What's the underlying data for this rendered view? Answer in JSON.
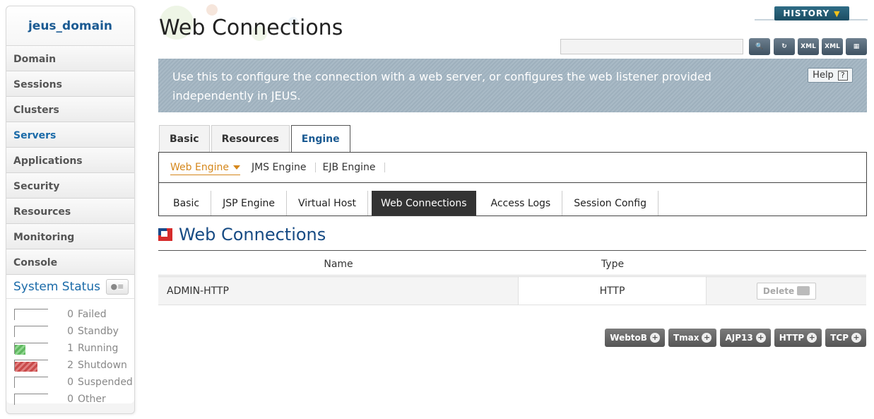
{
  "sidebar": {
    "domain": "jeus_domain",
    "items": [
      {
        "label": "Domain"
      },
      {
        "label": "Sessions"
      },
      {
        "label": "Clusters"
      },
      {
        "label": "Servers"
      },
      {
        "label": "Applications"
      },
      {
        "label": "Security"
      },
      {
        "label": "Resources"
      },
      {
        "label": "Monitoring"
      },
      {
        "label": "Console"
      }
    ],
    "active_item": "Servers",
    "system_status": {
      "title": "System Status",
      "rows": [
        {
          "count": "0",
          "label": "Failed",
          "fill": 0
        },
        {
          "count": "0",
          "label": "Standby",
          "fill": 0
        },
        {
          "count": "1",
          "label": "Running",
          "fill": 0.33
        },
        {
          "count": "2",
          "label": "Shutdown",
          "fill": 0.67
        },
        {
          "count": "0",
          "label": "Suspended",
          "fill": 0
        },
        {
          "count": "0",
          "label": "Other",
          "fill": 0
        }
      ]
    }
  },
  "header": {
    "title": "Web Connections",
    "history_label": "HISTORY",
    "search_value": "",
    "toolbar_icons": [
      "search-icon",
      "reload-icon",
      "export-xml-icon",
      "import-xml-icon",
      "tree-icon"
    ]
  },
  "banner": {
    "text": "Use this to configure the connection with a web server, or configures the web listener provided independently in JEUS.",
    "help_label": "Help"
  },
  "tabs": {
    "top": [
      {
        "label": "Basic"
      },
      {
        "label": "Resources"
      },
      {
        "label": "Engine"
      }
    ],
    "top_active": "Engine",
    "engine": [
      {
        "label": "Web Engine"
      },
      {
        "label": "JMS Engine"
      },
      {
        "label": "EJB Engine"
      }
    ],
    "engine_active": "Web Engine",
    "web_engine": [
      {
        "label": "Basic"
      },
      {
        "label": "JSP Engine"
      },
      {
        "label": "Virtual Host"
      },
      {
        "label": "Web Connections"
      },
      {
        "label": "Access Logs"
      },
      {
        "label": "Session Config"
      }
    ],
    "web_engine_active": "Web Connections"
  },
  "section": {
    "title": "Web Connections",
    "columns": {
      "name": "Name",
      "type": "Type"
    },
    "rows": [
      {
        "name": "ADMIN-HTTP",
        "type": "HTTP",
        "action": "Delete"
      }
    ]
  },
  "add_buttons": [
    {
      "label": "WebtoB"
    },
    {
      "label": "Tmax"
    },
    {
      "label": "AJP13"
    },
    {
      "label": "HTTP"
    },
    {
      "label": "TCP"
    }
  ],
  "colors": {
    "accent": "#1a5a92",
    "active_tab": "#d5871b",
    "running": "#5fb85f",
    "shutdown": "#c94a4a"
  }
}
